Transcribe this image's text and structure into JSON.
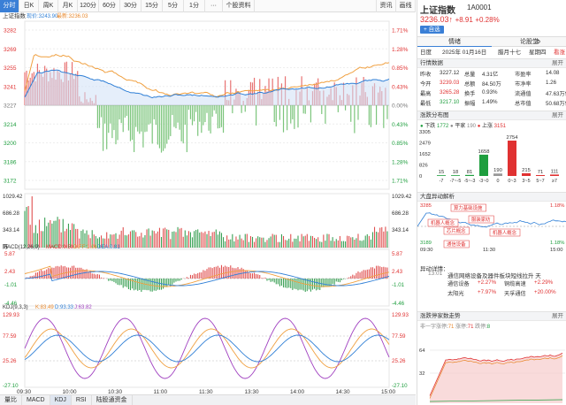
{
  "toolbar": {
    "items": [
      "分时",
      "日K",
      "周K",
      "月K",
      "120分",
      "60分",
      "30分",
      "15分",
      "5分",
      "1分",
      "···",
      "个股资料"
    ],
    "right": [
      "资讯",
      "画线"
    ],
    "active": 0
  },
  "main": {
    "index_name": "上证指数",
    "legend_prefix": "现价:",
    "legend_price": "3243.90",
    "legend_latest_prefix": "最新:",
    "legend_latest": "3236.03",
    "price_ticks": [
      {
        "v": "3282",
        "p": "1.71%",
        "c": "red"
      },
      {
        "v": "3269",
        "p": "1.28%",
        "c": "red"
      },
      {
        "v": "3255",
        "p": "0.85%",
        "c": "red"
      },
      {
        "v": "3241",
        "p": "0.43%",
        "c": "red"
      },
      {
        "v": "3227",
        "p": "0.00%",
        "c": "gry"
      },
      {
        "v": "3214",
        "p": "0.43%",
        "c": "grn"
      },
      {
        "v": "3200",
        "p": "0.85%",
        "c": "grn"
      },
      {
        "v": "3186",
        "p": "1.28%",
        "c": "grn"
      },
      {
        "v": "3172",
        "p": "1.71%",
        "c": "grn"
      }
    ],
    "vol_ticks": [
      "1029.42",
      "686.28",
      "343.14",
      "万"
    ],
    "macd": {
      "label": "MACD(12,26,9)",
      "macd": "MACD:0.50",
      "diff": "DIFF:1.06",
      "dea": "DEA:0.81",
      "ticks": [
        "5.87",
        "2.43",
        "-1.01",
        "-4.46"
      ]
    },
    "kdj": {
      "label": "KDJ(9,3,3)",
      "k": "K:83.49",
      "d": "D:93.33",
      "j": "J:63.82",
      "ticks": [
        "129.93",
        "77.59",
        "25.26",
        "-27.10"
      ]
    },
    "time_labels": [
      "09:30",
      "10:00",
      "10:30",
      "11:00",
      "11:30",
      "13:30",
      "14:00",
      "14:30",
      "15:00"
    ],
    "bottom_tabs": [
      "量比",
      "MACD",
      "KDJ",
      "RSI",
      "陆股通资金"
    ]
  },
  "stock": {
    "name": "上证指数",
    "code": "1A0001",
    "price": "3236.03",
    "arrow": "↑",
    "change": "+8.91",
    "pct": "+0.28%",
    "add_label": "+ 自选"
  },
  "tabs": [
    "情绪",
    "论股堂"
  ],
  "date_row": {
    "label": "日度",
    "date": "2025年 01月16日",
    "lunar": "腊月十七",
    "weekday": "星期四",
    "more": "看涨"
  },
  "quote": {
    "title": "行情数据",
    "more": "展开",
    "rows": [
      [
        "昨收",
        "3227.12",
        "总量",
        "4.31亿",
        "市盈率",
        "14.08"
      ],
      [
        "今开",
        "3239.03",
        "总额",
        "84.50万",
        "市净率",
        "1.26"
      ],
      [
        "最高",
        "3265.28",
        "换手",
        "0.93%",
        "流通值",
        "47.63万亿"
      ],
      [
        "最低",
        "3217.10",
        "振幅",
        "1.49%",
        "总市值",
        "50.68万亿"
      ]
    ]
  },
  "dist": {
    "title": "涨跌分布图",
    "more": "展开",
    "down_label": "下跌",
    "down": "1772",
    "flat_label": "平家",
    "flat": "190",
    "up_label": "上涨",
    "up": "3151",
    "bars": [
      {
        "v": 15,
        "l": "-7",
        "c": "#1e9e3e"
      },
      {
        "v": 18,
        "l": "-7~-5",
        "c": "#1e9e3e"
      },
      {
        "v": 81,
        "l": "-5~-3",
        "c": "#1e9e3e"
      },
      {
        "v": 1658,
        "l": "-3~0",
        "c": "#1e9e3e"
      },
      {
        "v": 190,
        "l": "0",
        "c": "#999999"
      },
      {
        "v": 2754,
        "l": "0~3",
        "c": "#e03232"
      },
      {
        "v": 215,
        "l": "3~5",
        "c": "#e03232"
      },
      {
        "v": 71,
        "l": "5~7",
        "c": "#e03232"
      },
      {
        "v": 111,
        "l": "≥7",
        "c": "#e03232"
      }
    ],
    "yticks": [
      "3305",
      "2479",
      "1652",
      "826",
      "0"
    ]
  },
  "intraday": {
    "title": "大盘异动解析",
    "top": "3285",
    "top_pct": "1.18%",
    "bot": "3189",
    "bot_pct": "1.18%",
    "t0": "09:30",
    "t1": "11:30",
    "t2": "15:00",
    "tags": [
      "算力基础设施",
      "机器人概念",
      "服装家纺",
      "芯片概念",
      "机器人概念",
      "通信设备"
    ]
  },
  "news": {
    "title": "异动详情：",
    "time": "13:01",
    "headline": "通信网络设备及器件板块短线拉升 天",
    "items": [
      [
        "通信设备",
        "+2.27%"
      ],
      [
        "铜缆高速",
        "+2.29%"
      ],
      [
        "太阳光",
        "+7.97%"
      ],
      [
        "天孚通信",
        "+20.00%"
      ]
    ]
  },
  "limit": {
    "title": "涨跌停家数走势",
    "more": "展开",
    "legend": [
      "非一字涨停",
      "71",
      "涨停",
      "71",
      "跌停",
      "8"
    ],
    "yticks": [
      "64",
      "32"
    ]
  }
}
